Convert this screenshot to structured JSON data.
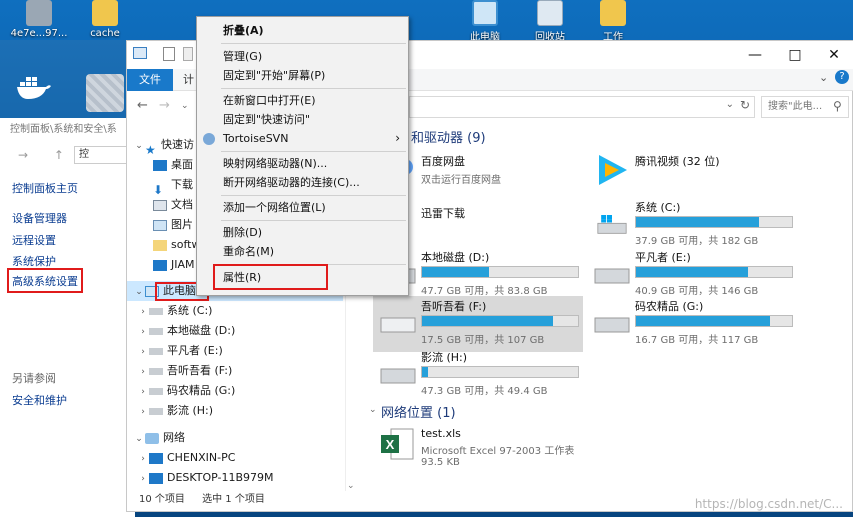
{
  "desktop": {
    "icons": [
      {
        "label": "4e7e...97..."
      },
      {
        "label": "cache"
      },
      {
        "label": "此电脑"
      },
      {
        "label": "回收站"
      },
      {
        "label": "工作"
      }
    ]
  },
  "control_panel": {
    "breadcrumb": "控制面板\\系统和安全\\系",
    "addr_text": "控",
    "home_link": "控制面板主页",
    "links": [
      "设备管理器",
      "远程设置",
      "系统保护",
      "高级系统设置"
    ],
    "see_also": "另请参阅",
    "security": "安全和维护"
  },
  "explorer": {
    "file_tab": "文件",
    "tab2": "计",
    "search_placeholder": "搜索\"此电...",
    "status_items": "10 个项目",
    "status_selected": "选中 1 个项目",
    "sections": {
      "devices": "设备和驱动器 (9)",
      "devices_visible": "和驱动器 (9)",
      "network": "网络位置 (1)"
    },
    "tree": {
      "quick_access": "快速访",
      "quick_items": [
        "桌面",
        "下载",
        "文档",
        "图片",
        "softw",
        "JIAM"
      ],
      "this_pc": "此电脑",
      "drives": [
        "系统 (C:)",
        "本地磁盘 (D:)",
        "平凡者 (E:)",
        "吾听吾看 (F:)",
        "码农精品 (G:)",
        "影流 (H:)"
      ],
      "network": "网络",
      "network_items": [
        "CHENXIN-PC",
        "DESKTOP-11B979M"
      ]
    },
    "items": {
      "baidu": {
        "name": "百度网盘",
        "sub": "双击运行百度网盘"
      },
      "tencent": {
        "name": "腾讯视频 (32 位)"
      },
      "xunlei": {
        "name": "迅雷下载"
      },
      "c": {
        "name": "系统 (C:)",
        "free": "37.9 GB 可用，共 182 GB",
        "used": 0.79
      },
      "d": {
        "name": "本地磁盘 (D:)",
        "free": "47.7 GB 可用，共 83.8 GB",
        "used": 0.43
      },
      "e": {
        "name": "平凡者 (E:)",
        "free": "40.9 GB 可用，共 146 GB",
        "used": 0.72
      },
      "f": {
        "name": "吾听吾看 (F:)",
        "free": "17.5 GB 可用，共 107 GB",
        "used": 0.84
      },
      "g": {
        "name": "码农精品 (G:)",
        "free": "16.7 GB 可用，共 117 GB",
        "used": 0.86
      },
      "h": {
        "name": "影流 (H:)",
        "free": "47.3 GB 可用，共 49.4 GB",
        "used": 0.04
      },
      "xls": {
        "name": "test.xls",
        "type": "Microsoft Excel 97-2003 工作表",
        "size": "93.5 KB"
      }
    }
  },
  "context_menu": {
    "items": [
      "折叠(A)",
      "管理(G)",
      "固定到\"开始\"屏幕(P)",
      "在新窗口中打开(E)",
      "固定到\"快速访问\"",
      "TortoiseSVN",
      "映射网络驱动器(N)...",
      "断开网络驱动器的连接(C)...",
      "添加一个网络位置(L)",
      "删除(D)",
      "重命名(M)",
      "属性(R)"
    ]
  },
  "watermark": "https://blog.csdn.net/C..."
}
